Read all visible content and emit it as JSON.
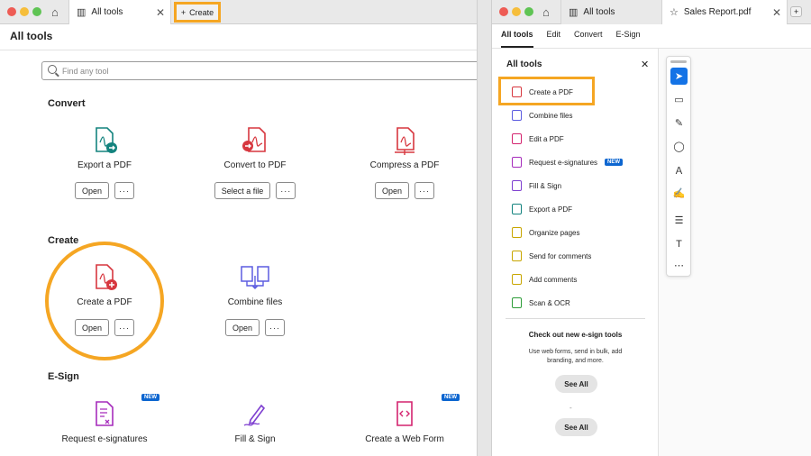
{
  "left": {
    "tab_title": "All tools",
    "create_label": "Create",
    "page_title": "All tools",
    "search_placeholder": "Find any tool",
    "sections": {
      "convert": "Convert",
      "create": "Create",
      "esign": "E-Sign"
    },
    "tools": {
      "export_pdf": {
        "name": "Export a PDF",
        "btn": "Open"
      },
      "convert_pdf": {
        "name": "Convert to PDF",
        "btn": "Select a file"
      },
      "compress_pdf": {
        "name": "Compress a PDF",
        "btn": "Open"
      },
      "create_pdf": {
        "name": "Create a PDF",
        "btn": "Open"
      },
      "combine_files": {
        "name": "Combine files",
        "btn": "Open"
      },
      "request_esign": {
        "name": "Request e-signatures",
        "badge": "NEW"
      },
      "fill_sign": {
        "name": "Fill & Sign"
      },
      "web_form": {
        "name": "Create a Web Form",
        "badge": "NEW"
      }
    },
    "more_label": "···"
  },
  "right": {
    "tab_all_tools": "All tools",
    "tab_doc": "Sales Report.pdf",
    "nav_tabs": [
      "All tools",
      "Edit",
      "Convert",
      "E-Sign"
    ],
    "panel_title": "All tools",
    "items": [
      {
        "label": "Create a PDF",
        "color": "#d7373f"
      },
      {
        "label": "Combine files",
        "color": "#5c5ce0"
      },
      {
        "label": "Edit a PDF",
        "color": "#d4246f"
      },
      {
        "label": "Request e-signatures",
        "color": "#a62cbc",
        "badge": "NEW"
      },
      {
        "label": "Fill & Sign",
        "color": "#7e3fd0"
      },
      {
        "label": "Export a PDF",
        "color": "#13837e"
      },
      {
        "label": "Organize pages",
        "color": "#c8a600"
      },
      {
        "label": "Send for comments",
        "color": "#c8a600"
      },
      {
        "label": "Add comments",
        "color": "#c8a600"
      },
      {
        "label": "Scan & OCR",
        "color": "#2d9d38"
      }
    ],
    "promo_title": "Check out new e-sign tools",
    "promo_text": "Use web forms, send in bulk, add branding, and more.",
    "see_all": "See All",
    "dash": "-"
  },
  "colors": {
    "highlight": "#f5a623",
    "accent": "#1473e6",
    "new_badge": "#0d66d0"
  }
}
